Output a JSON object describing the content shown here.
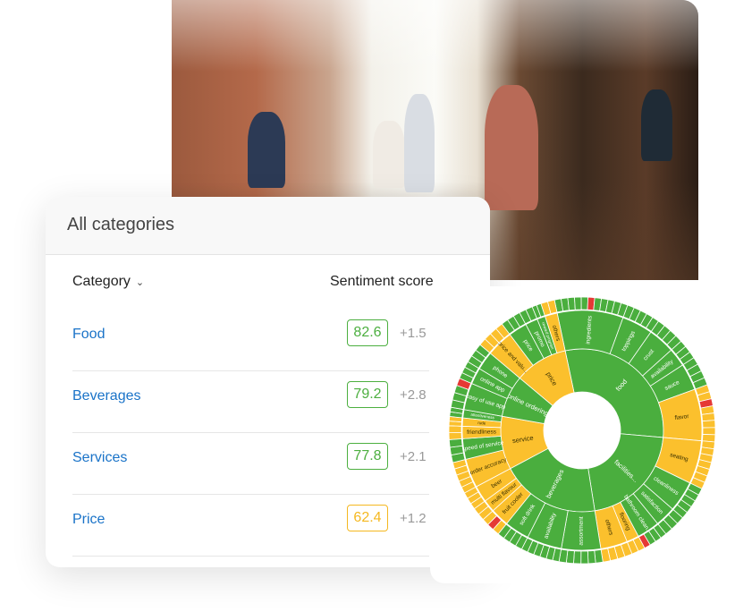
{
  "photo": {
    "subject": "cafe-interior-photo"
  },
  "table_card": {
    "title": "All categories",
    "columns": {
      "category": "Category",
      "score": "Sentiment score"
    },
    "rows": [
      {
        "category": "Food",
        "score": "82.6",
        "delta": "+1.5",
        "status": "positive",
        "color": "#4caf3f"
      },
      {
        "category": "Beverages",
        "score": "79.2",
        "delta": "+2.8",
        "status": "positive",
        "color": "#4caf3f"
      },
      {
        "category": "Services",
        "score": "77.8",
        "delta": "+2.1",
        "status": "positive",
        "color": "#4caf3f"
      },
      {
        "category": "Price",
        "score": "62.4",
        "delta": "+1.2",
        "status": "neutral",
        "color": "#f5b820"
      }
    ]
  },
  "colors": {
    "positive": "#4aae3e",
    "neutral": "#fbc02d",
    "negative": "#e53935",
    "link": "#1a73c8"
  },
  "chart_data": {
    "type": "sunburst",
    "rings": [
      {
        "label": "food",
        "status": "positive",
        "value": 107,
        "children": [
          {
            "label": "ingredients",
            "status": "positive",
            "value": 32
          },
          {
            "label": "toppings",
            "status": "positive",
            "value": 15
          },
          {
            "label": "crust",
            "status": "positive",
            "value": 13
          },
          {
            "label": "availability",
            "status": "positive",
            "value": 9
          },
          {
            "label": "sauce",
            "status": "positive",
            "value": 13
          },
          {
            "label": "flavor",
            "status": "neutral",
            "value": 25
          }
        ]
      },
      {
        "label": "facilities...",
        "status": "positive",
        "value": 76,
        "children": [
          {
            "label": "seating",
            "status": "neutral",
            "value": 21
          },
          {
            "label": "cleanliness",
            "status": "positive",
            "value": 15
          },
          {
            "label": "satisfaction",
            "status": "positive",
            "value": 10
          },
          {
            "label": "bathroom clean...",
            "status": "positive",
            "value": 11
          },
          {
            "label": "flooring",
            "status": "neutral",
            "value": 6
          },
          {
            "label": "others",
            "status": "neutral",
            "value": 13
          }
        ]
      },
      {
        "label": "beverages",
        "status": "positive",
        "value": 71,
        "children": [
          {
            "label": "assortment",
            "status": "positive",
            "value": 19
          },
          {
            "label": "availability",
            "status": "positive",
            "value": 17
          },
          {
            "label": "soft drink",
            "status": "positive",
            "value": 12
          },
          {
            "label": "fruit cooler",
            "status": "neutral",
            "value": 9
          },
          {
            "label": "multi flavour",
            "status": "neutral",
            "value": 6
          },
          {
            "label": "beer",
            "status": "neutral",
            "value": 8
          }
        ]
      },
      {
        "label": "service",
        "status": "neutral",
        "value": 38,
        "children": [
          {
            "label": "order accuracy",
            "status": "neutral",
            "value": 14
          },
          {
            "label": "speed of service",
            "status": "positive",
            "value": 10
          },
          {
            "label": "friendliness",
            "status": "neutral",
            "value": 6
          },
          {
            "label": "rude",
            "status": "neutral",
            "value": 4
          },
          {
            "label": "attentiveness",
            "status": "positive",
            "value": 4
          }
        ]
      },
      {
        "label": "online ordering",
        "status": "positive",
        "value": 30,
        "children": [
          {
            "label": "easy of use app",
            "status": "positive",
            "value": 13
          },
          {
            "label": "online app",
            "status": "positive",
            "value": 8
          },
          {
            "label": "phone",
            "status": "positive",
            "value": 9
          }
        ]
      },
      {
        "label": "price",
        "status": "neutral",
        "value": 38,
        "children": [
          {
            "label": "price and valu...",
            "status": "neutral",
            "value": 13
          },
          {
            "label": "price",
            "status": "positive",
            "value": 9
          },
          {
            "label": "promo",
            "status": "positive",
            "value": 6
          },
          {
            "label": "reward program",
            "status": "positive",
            "value": 4
          },
          {
            "label": "others",
            "status": "neutral",
            "value": 6
          }
        ]
      }
    ]
  }
}
